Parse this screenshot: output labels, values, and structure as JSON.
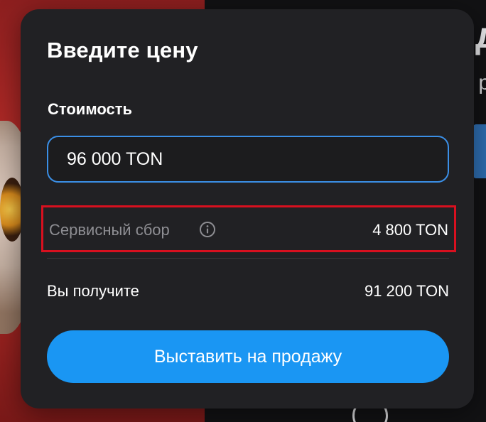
{
  "dialog": {
    "title": "Введите цену",
    "price_label": "Стоимость",
    "price_value": "96 000 TON",
    "fee_label": "Сервисный сбор",
    "fee_info_icon": "info-circle-icon",
    "fee_value": "4 800 TON",
    "receive_label": "Вы получите",
    "receive_value": "91 200 TON",
    "submit_label": "Выставить на продажу"
  },
  "background": {
    "partial_heading": "д",
    "partial_text": "р"
  },
  "colors": {
    "accent": "#1a96f3",
    "input_border": "#3b8fe6",
    "highlight_box": "#d8101f",
    "dialog_bg": "#212124",
    "muted_text": "#8e8e93"
  }
}
